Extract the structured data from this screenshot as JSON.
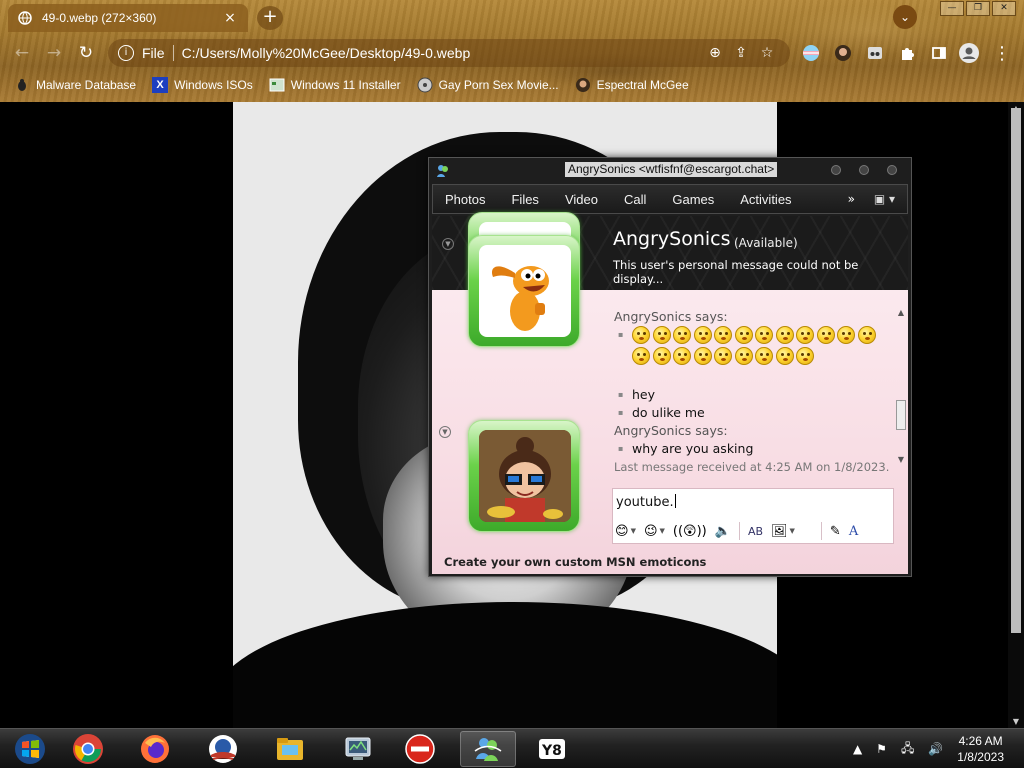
{
  "browser": {
    "tab": {
      "title": "49-0.webp (272×360)",
      "close": "×"
    },
    "new_tab": "+",
    "tab_search": "⌄",
    "window_controls": [
      "—",
      "❐",
      "✕"
    ],
    "nav": {
      "back": "←",
      "forward": "→",
      "reload": "↻"
    },
    "omnibox": {
      "info": "i",
      "scheme": "File",
      "url": "C:/Users/Molly%20McGee/Desktop/49-0.webp",
      "zoom_icon": "⊕",
      "share_icon": "⇪",
      "star_icon": "☆"
    },
    "menu_icon": "⋮",
    "bookmarks": [
      {
        "label": "Malware Database",
        "icon": "bug-icon"
      },
      {
        "label": "Windows ISOs",
        "icon": "x-icon"
      },
      {
        "label": "Windows 11 Installer",
        "icon": "installer-icon"
      },
      {
        "label": "Gay Porn Sex Movie...",
        "icon": "cd-icon"
      },
      {
        "label": "Espectral McGee",
        "icon": "avatar-icon"
      }
    ]
  },
  "msn": {
    "title": "AngrySonics <wtfisfnf@escargot.chat>",
    "menu": [
      "Photos",
      "Files",
      "Video",
      "Call",
      "Games",
      "Activities"
    ],
    "more": "»",
    "contact": {
      "name": "AngrySonics",
      "status": "(Available)",
      "personal_message": "This user's personal message could not be display..."
    },
    "chat": {
      "sender1": "AngrySonics says:",
      "emoticon_rows": [
        12,
        9
      ],
      "sender2": "",
      "msg2a": "hey",
      "msg2b": "do ulike me",
      "sender3": "AngrySonics says:",
      "msg3": "why are you asking"
    },
    "last_message": "Last message received at 4:25 AM on 1/8/2023.",
    "input_text": "youtube.",
    "ad_text": "Create your own custom MSN emoticons",
    "accent": "#5cc93b"
  },
  "taskbar": {
    "apps": [
      "windows-start-icon",
      "chrome-icon",
      "firefox-icon",
      "obama-logo-icon",
      "file-explorer-icon",
      "system-monitor-icon",
      "no-entry-icon",
      "msn-messenger-icon",
      "y8-icon"
    ],
    "clock_time": "4:26 AM",
    "clock_date": "1/8/2023"
  }
}
